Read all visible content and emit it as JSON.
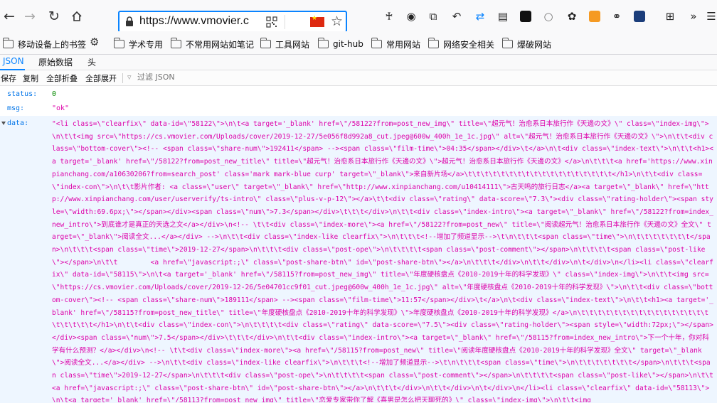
{
  "browser": {
    "url": "https://www.vmovier.c",
    "icons": {
      "back": "arrow-left-icon",
      "forward": "arrow-right-icon",
      "reload": "reload-icon",
      "home": "home-icon"
    }
  },
  "bookmarks": [
    {
      "label": "移动设备上的书签",
      "icon": "mobile-bookmarks-icon"
    },
    {
      "label": "学术专用",
      "icon": "folder-icon"
    },
    {
      "label": "不常用网站如笔记",
      "icon": "folder-icon"
    },
    {
      "label": "工具网站",
      "icon": "folder-icon"
    },
    {
      "label": "git-hub",
      "icon": "folder-icon"
    },
    {
      "label": "常用网站",
      "icon": "folder-icon"
    },
    {
      "label": "网络安全相关",
      "icon": "folder-icon"
    },
    {
      "label": "爆破网站",
      "icon": "folder-icon"
    }
  ],
  "json_viewer": {
    "tabs": [
      "JSON",
      "原始数据",
      "头"
    ],
    "toolbar": {
      "save": "保存",
      "copy": "复制",
      "collapse_all": "全部折叠",
      "expand_all": "全部展开",
      "filter_placeholder": "过滤 JSON"
    },
    "rows": [
      {
        "key": "status:",
        "value": "0"
      },
      {
        "key": "msg:",
        "value": "\"ok\""
      },
      {
        "key": "data:",
        "value": "\"<li class=\\\"clearfix\\\" data-id=\\\"58122\\\">\\n\\t<a target='_blank' href=\\\"/58122?from=post_new_img\\\" title=\\\"超元气！治愈系日本旅行作《天邊の文》\\\" class=\\\"index-img\\\">\\n\\t\\t<img src=\\\"https://cs.vmovier.com/Uploads/cover/2019-12-27/5e056f8d992a8_cut.jpeg@600w_400h_1e_1c.jpg\\\" alt=\\\"超元气！治愈系日本旅行作《天邊の文》\\\">\\n\\t\\t<div class=\\\"bottom-cover\\\"><!-- <span class=\\\"share-num\\\">192411</span> --><span class=\\\"film-time\\\">04:35</span></div>\\t</a>\\n\\t<div class=\\\"index-text\\\">\\n\\t\\t<h1><a target='_blank' href=\\\"/58122?from=post_new_title\\\" title=\\\"超元气！治愈系日本旅行作《天邊の文》\\\">超元气！治愈系日本旅行作《天邊の文》</a>\\n\\t\\t\\t<a href='https://www.xinpianchang.com/a10630206?from=search_post' class='mark mark-blue curp' target=\\\"_blank\\\">来自新片场</a>\\t\\t\\t\\t\\t\\t\\t\\t\\t\\t\\t\\t\\t\\t\\t\\t\\t\\t</h1>\\n\\t\\t<div class=\\\"index-con\\\">\\n\\t\\t影片作者: <a class=\\\"user\\\" target=\\\"_blank\\\" href=\\\"http://www.xinpianchang.com/u10414111\\\">古天鸣的旅行日志</a><a target=\\\"_blank\\\" href=\\\"http://www.xinpianchang.com/user/userverify/ts-intro\\\" class=\\\"plus-v-p-12\\\"></a>\\t\\t<div class=\\\"rating\\\" data-score=\\\"7.3\\\"><div class=\\\"rating-holder\\\"><span style=\\\"width:69.6px;\\\"></span></div><span class=\\\"num\\\">7.3</span></div>\\t\\t\\t</div>\\n\\t\\t<div class=\\\"index-intro\\\"><a target=\\\"_blank\\\" href=\\\"/58122?from=index_new_intro\\\">到底谁才是真正的天选之文</a></div>\\n<!-- \\t\\t<div class=\\\"index-more\\\"><a href=\\\"/58122?from=post_new\\\" title=\\\"阅读超元气！治愈系日本旅行作《天邊の文》全文\\\" target=\\\"_blank\\\">阅读全文...</a></div> -->\\n\\t\\t<div class=\\\"index-like clearfix\\\">\\n\\t\\t\\t<!--增加了频道显示-->\\t\\n\\t\\t\\t<span class=\\\"time\\\">\\n\\t\\t\\t\\t\\t\\t\\t</span>\\n\\t\\t\\t<span class=\\\"time\\\">2019-12-27</span>\\n\\t\\t\\t<div class=\\\"post-ope\\\">\\n\\t\\t\\t\\t<span class=\\\"post-comment\\\"></span>\\n\\t\\t\\t\\t<span class=\\\"post-like\\\"></span>\\n\\t\\t        <a href=\\\"javascript:;\\\" class=\\\"post-share-btn\\\" id=\\\"post-share-btn\\\"></a>\\n\\t\\t\\t</div>\\n\\t\\t</div>\\n\\t</div>\\n</li><li class=\\\"clearfix\\\" data-id=\\\"58115\\\">\\n\\t<a target='_blank' href=\\\"/58115?from=post_new_img\\\" title=\\\"年度硬核盘点《2010-2019十年的科学发现》\\\" class=\\\"index-img\\\">\\n\\t\\t<img src=\\\"https://cs.vmovier.com/Uploads/cover/2019-12-26/5e04701cc9f01_cut.jpeg@600w_400h_1e_1c.jpg\\\" alt=\\\"年度硬核盘点《2010-2019十年的科学发现》\\\">\\n\\t\\t<div class=\\\"bottom-cover\\\"><!-- <span class=\\\"share-num\\\">189111</span> --><span class=\\\"film-time\\\">11:57</span></div>\\t</a>\\n\\t<div class=\\\"index-text\\\">\\n\\t\\t<h1><a target='_blank' href=\\\"/58115?from=post_new_title\\\" title=\\\"年度硬核盘点《2010-2019十年的科学发现》\\\">年度硬核盘点《2010-2019十年的科学发现》</a>\\n\\t\\t\\t\\t\\t\\t\\t\\t\\t\\t\\t\\t\\t\\t\\t\\t\\t\\t\\t\\t\\t</h1>\\n\\t\\t<div class=\\\"index-con\\\">\\n\\t\\t\\t\\t<div class=\\\"rating\\\" data-score=\\\"7.5\\\"><div class=\\\"rating-holder\\\"><span style=\\\"width:72px;\\\"></span></div><span class=\\\"num\\\">7.5</span></div>\\t\\t\\t</div>\\n\\t\\t<div class=\\\"index-intro\\\"><a target=\\\"_blank\\\" href=\\\"/58115?from=index_new_intro\\\">下一个十年，你对科学有什么预测？</a></div>\\n<!-- \\t\\t<div class=\\\"index-more\\\"><a href=\\\"/58115?from=post_new\\\" title=\\\"阅读年度硬核盘点《2010-2019十年的科学发现》全文\\\" target=\\\"_blank\\\">阅读全文...</a></div> -->\\n\\t\\t<div class=\\\"index-like clearfix\\\">\\n\\t\\t\\t<!--增加了频道显示-->\\t\\n\\t\\t\\t<span class=\\\"time\\\">\\n\\t\\t\\t\\t\\t\\t\\t</span>\\n\\t\\t\\t<span class=\\\"time\\\">2019-12-27</span>\\n\\t\\t\\t<div class=\\\"post-ope\\\">\\n\\t\\t\\t\\t<span class=\\\"post-comment\\\"></span>\\n\\t\\t\\t\\t<span class=\\\"post-like\\\"></span>\\n\\t\\t        <a href=\\\"javascript:;\\\" class=\\\"post-share-btn\\\" id=\\\"post-share-btn\\\"></a>\\n\\t\\t\\t</div>\\n\\t\\t</div>\\n\\t</div>\\n</li><li class=\\\"clearfix\\\" data-id=\\\"58113\\\">\\n\\t<a target='_blank' href=\\\"/58113?from=post_new_img\\\" title=\\\"恋爱专家带你了解《喜男是怎么把天聊死的》\\\" class=\\\"index-img\\\">\\n\\t\\t<img"
      }
    ]
  },
  "colors": {
    "accent": "#0a84ff",
    "key": "#0074e8",
    "number": "#058b00",
    "string": "#dd00a9"
  }
}
